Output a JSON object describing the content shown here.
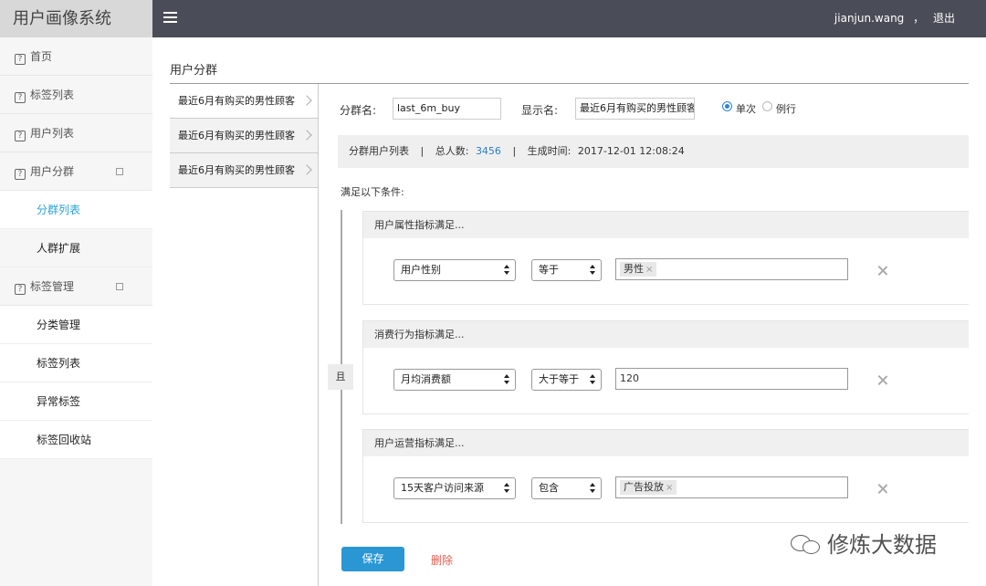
{
  "app": {
    "title": "用户画像系统"
  },
  "topbar": {
    "username": "jianjun.wang",
    "separator": "，",
    "logout": "退出"
  },
  "sidebar": {
    "items": [
      {
        "label": "首页"
      },
      {
        "label": "标签列表"
      },
      {
        "label": "用户列表"
      },
      {
        "label": "用户分群",
        "children": [
          {
            "label": "分群列表",
            "active": true
          },
          {
            "label": "人群扩展"
          }
        ]
      },
      {
        "label": "标签管理",
        "children": [
          {
            "label": "分类管理"
          },
          {
            "label": "标签列表"
          },
          {
            "label": "异常标签"
          },
          {
            "label": "标签回收站"
          }
        ]
      }
    ]
  },
  "page": {
    "title": "用户分群"
  },
  "groups": [
    {
      "label": "最近6月有购买的男性顾客"
    },
    {
      "label": "最近6月有购买的男性顾客"
    },
    {
      "label": "最近6月有购买的男性顾客"
    }
  ],
  "form": {
    "group_name_label": "分群名:",
    "group_name_value": "last_6m_buy",
    "display_name_label": "显示名:",
    "display_name_value": "最近6月有购买的男性顾客",
    "radio_once": "单次",
    "radio_routine": "例行",
    "selected_radio": "单次"
  },
  "info": {
    "list_label": "分群用户列表",
    "sep": "|",
    "total_label": "总人数:",
    "total_value": "3456",
    "created_label": "生成时间:",
    "created_value": "2017-12-01  12:08:24"
  },
  "conditions": {
    "heading": "满足以下条件:",
    "logic": "且",
    "groups": [
      {
        "title": "用户属性指标满足...",
        "field": "用户性别",
        "operator": "等于",
        "tag": "男性",
        "tag_close": "×"
      },
      {
        "title": "消费行为指标满足...",
        "field": "月均消费额",
        "operator": "大于等于",
        "value": "120"
      },
      {
        "title": "用户运营指标满足...",
        "field": "15天客户访问来源",
        "operator": "包含",
        "tag": "广告投放",
        "tag_close": "×"
      }
    ]
  },
  "actions": {
    "save": "保存",
    "delete": "删除"
  },
  "watermark": {
    "text": "修炼大数据"
  },
  "colors": {
    "accent": "#2a97d4",
    "topbar": "#4a4d57",
    "danger": "#e05a4f",
    "active_nav": "#29a3d6"
  }
}
